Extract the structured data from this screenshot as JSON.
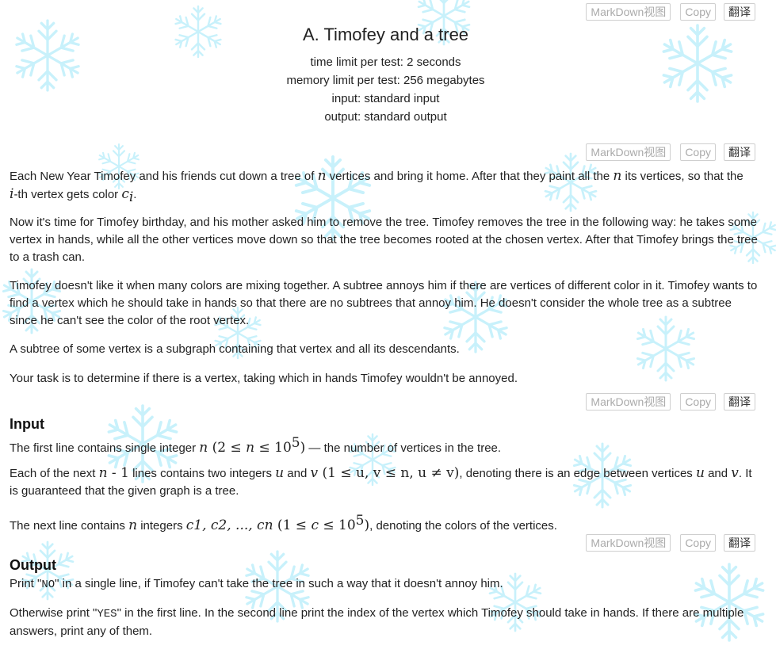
{
  "toolbar": {
    "markdown_label": "MarkDown视图",
    "copy_label": "Copy",
    "translate_label": "翻译"
  },
  "problem": {
    "title": "A. Timofey and a tree",
    "time_limit": "time limit per test: 2 seconds",
    "memory_limit": "memory limit per test: 256 megabytes",
    "input_file": "input: standard input",
    "output_file": "output: standard output"
  },
  "statement": {
    "p1_a": "Each New Year Timofey and his friends cut down a tree of ",
    "p1_n": "n",
    "p1_b": " vertices and bring it home. After that they paint all the ",
    "p1_n2": "n",
    "p1_c": " its vertices, so that the",
    "p1_i": "i",
    "p1_d": "-th vertex gets color ",
    "p1_c_sym": "c",
    "p1_c_sub": "i",
    "p1_e": ".",
    "p2": "Now it's time for Timofey birthday, and his mother asked him to remove the tree. Timofey removes the tree in the following way: he takes some vertex in hands, while all the other vertices move down so that the tree becomes rooted at the chosen vertex. After that Timofey brings the tree to a trash can.",
    "p3": "Timofey doesn't like it when many colors are mixing together. A subtree annoys him if there are vertices of different color in it. Timofey wants to find a vertex which he should take in hands so that there are no subtrees that annoy him. He doesn't consider the whole tree as a subtree since he can't see the color of the root vertex.",
    "p4": "A subtree of some vertex is a subgraph containing that vertex and all its descendants.",
    "p5": "Your task is to determine if there is a vertex, taking which in hands Timofey wouldn't be annoyed."
  },
  "input": {
    "heading": "Input",
    "l1_a": "The first line contains single integer ",
    "l1_math": "n",
    "l1_range_open": " (2 ≤ ",
    "l1_range_n": "n",
    "l1_range_mid": " ≤ 10",
    "l1_exp": "5",
    "l1_range_close": ")",
    "l1_b": " — the number of vertices in the tree.",
    "l2_a": "Each of the next ",
    "l2_n": "n",
    "l2_minus": " - 1",
    "l2_b": " lines contains two integers ",
    "l2_u": "u",
    "l2_and": " and ",
    "l2_v": "v",
    "l2_cond": " (1 ≤ u, v ≤ n, u ≠ v)",
    "l2_c": ", denoting there is an edge between vertices ",
    "l2_u2": "u",
    "l2_and2": " and ",
    "l2_v2": "v",
    "l2_d": ". It is guaranteed that the given graph is a tree.",
    "l3_a": "The next line contains ",
    "l3_n": "n",
    "l3_b": " integers ",
    "l3_list": "c1, c2, ..., cn",
    "l3_cond_open": " (1 ≤ ",
    "l3_ci": "c",
    "l3_cond_mid": " ≤ 10",
    "l3_exp": "5",
    "l3_cond_close": ")",
    "l3_c": ", denoting the colors of the vertices."
  },
  "output": {
    "heading": "Output",
    "l1_a": "Print \"",
    "l1_no": "NO",
    "l1_b": "\" in a single line, if Timofey can't take the tree in such a way that it doesn't annoy him.",
    "l2_a": "Otherwise print \"",
    "l2_yes": "YES",
    "l2_b": "\" in the first line. In the second line print the index of the vertex which Timofey should take in hands. If there are multiple answers, print any of them."
  },
  "colors": {
    "snowflake": "#c8f1fb",
    "text": "#222222",
    "button_text": "#aaaaaa",
    "button_border": "#cfcfcf"
  }
}
